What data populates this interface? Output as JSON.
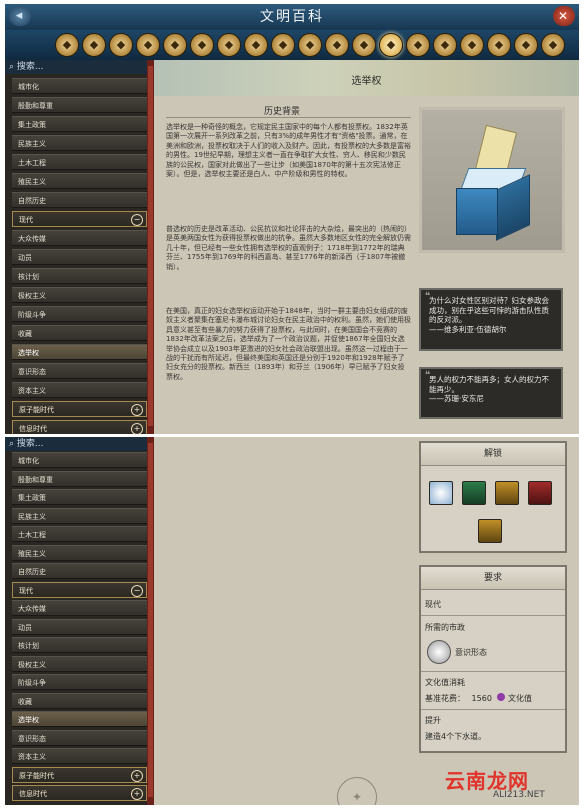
{
  "window": {
    "title": "文明百科"
  },
  "category_icons": [
    "chrome-gear-icon",
    "flag-icon",
    "scroll-icon",
    "tower-icon",
    "wonder-icon",
    "pillar-icon",
    "globe-icon",
    "person-icon",
    "book-icon",
    "district-icon",
    "citizen-icon",
    "city-icon",
    "building-icon",
    "leaf-icon",
    "mountain-icon",
    "temple-icon",
    "chart-icon",
    "star-icon",
    "crown-icon"
  ],
  "sidebar": {
    "search_label": "搜索...",
    "items": [
      "城市化",
      "殷勤和尊重",
      "集土政策",
      "民族主义",
      "土木工程",
      "殖民主义",
      "自然历史",
      "现代",
      "大众传媒",
      "动员",
      "核计划",
      "极权主义",
      "阶级斗争",
      "收藏",
      "选举权",
      "意识形态",
      "资本主义",
      "原子能时代",
      "信息时代"
    ]
  },
  "sidebar_bottom": {
    "items": [
      "城市化",
      "殷勤和尊重",
      "集土政策",
      "民族主义",
      "土木工程",
      "殖民主义",
      "自然历史",
      "现代",
      "大众传媒",
      "动员",
      "核计划",
      "极权主义",
      "阶级斗争",
      "收藏",
      "选举权",
      "意识形态",
      "资本主义",
      "原子能时代",
      "信息时代"
    ]
  },
  "article": {
    "title": "选举权",
    "section_title": "历史背景",
    "paragraphs": [
      "选举权是一种奇怪的概念，它规定民主国家中的每个人都有投票权。1832年英国第一次展开一系列改革之前，只有3%的成年男性才有\"资格\"投票。通常，在美洲和欧洲，投票权取决于人们的收入及财产。因此，有投票权的大多数是富裕的男性。19世纪早期，理想主义者一直在争取扩大女性、穷人、移民和少数民族的公民权，国家对此做出了一些让步（如美国1870年的第十五次宪法修正案）。但是，选举权主要还是白人、中产阶级和男性的特权。",
      "普选权的历史是改革活动、公民抗议和社论抨击的大杂烩，最突出的（热闹的）是英美两国女性为获得投票权做出的抗争。虽然大多数地区女性的完全解放仍需几十年，但已经有一些女性拥有选举权的直观例子：1718年到1772年的瑞典芬兰、1755年到1769年的科西嘉岛、甚至1776年的新泽西（于1807年被撤销）。",
      "在美国，真正的妇女选举权运动开始于1848年，当时一群主要由妇女组成的废奴主义者聚集在塞尼卡瀑布城讨论妇女在民主政治中的权利。虽然，她们使用极具意义甚至有些暴力的努力获得了投票权，与此同时，在美国国会不竞赛的1832年改革法案之后，选举成为了一个政治议题，并促使1867年全国妇女选举协会成立以及1903年更激进的妇女社会政治联盟出现。虽然这一过程由于一战的干扰而有所延迟，但最终美国和英国还是分别于1920年和1928年赋予了妇女充分的投票权。新西兰（1893年）和芬兰（1906年）早已赋予了妇女投票权。"
    ],
    "quotes": [
      {
        "text": "为什么对女性区别对待？妇女参政会成功，别在乎这些可悖的游击队性质的反对派。",
        "author": "——维多利亚·伍德胡尔"
      },
      {
        "text": "男人的权力不能再多；女人的权力不能再少。",
        "author": "——苏珊·安东尼"
      }
    ]
  },
  "unlocks": {
    "title": "解锁"
  },
  "requirements": {
    "title": "要求",
    "era": "现代",
    "civic_label": "所需的市政",
    "civic": "意识形态",
    "cost_label": "文化值消耗",
    "base_cost_label": "基准花费：",
    "base_cost_value": "1560",
    "culture_label": "文化值",
    "boost_label": "提升",
    "boost_text": "建造4个下水道。"
  },
  "watermark": {
    "main": "云南龙网",
    "sub": "ALI213.NET"
  },
  "colors": {
    "title_bar": "#1e4666",
    "accent_gold": "#b0863c",
    "scrollbar": "#6b2119",
    "parchment": "#ccc6b7"
  }
}
